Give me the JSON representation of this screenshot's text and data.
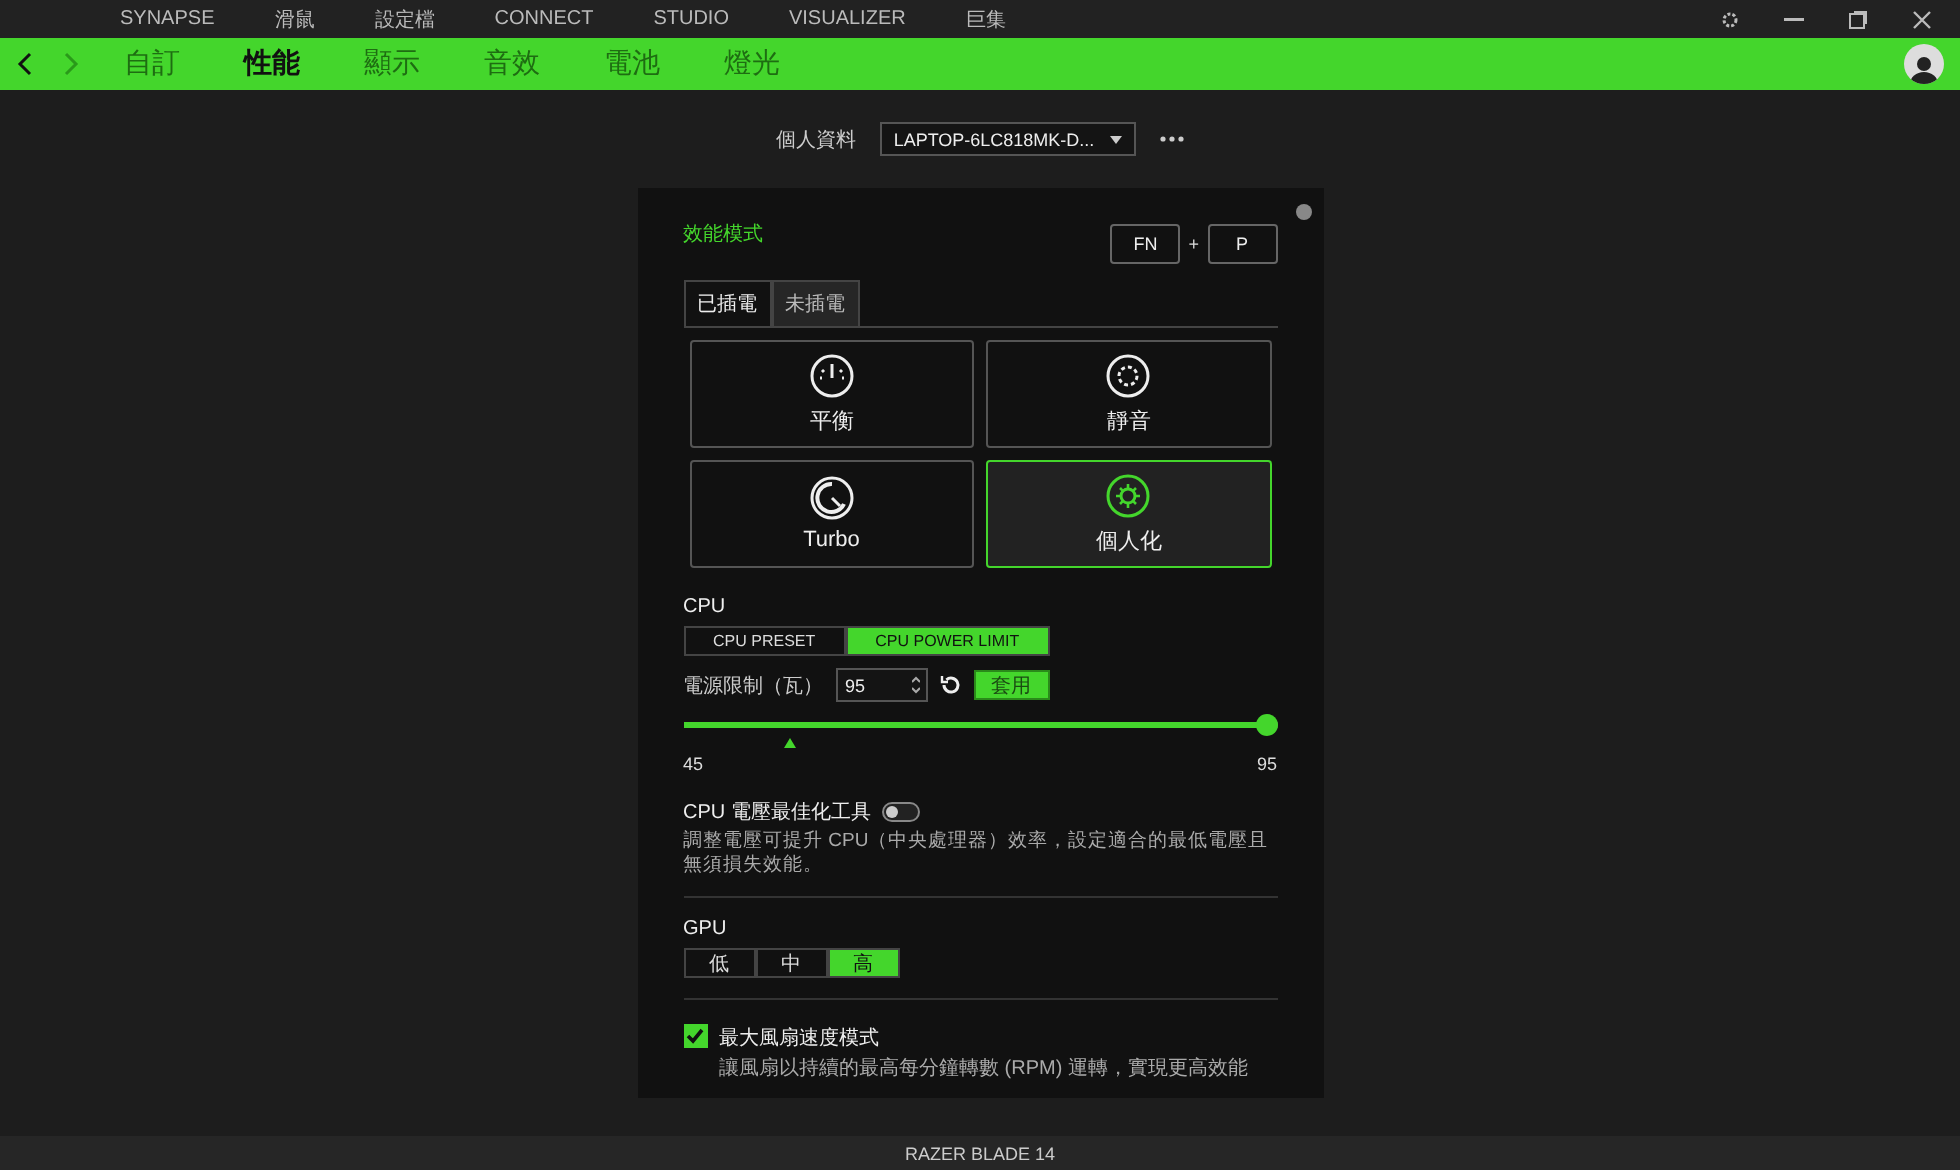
{
  "top_menu": [
    {
      "label": "SYNAPSE",
      "selected": false
    },
    {
      "label": "滑鼠",
      "selected": false
    },
    {
      "label": "設定檔",
      "selected": false
    },
    {
      "label": "CONNECT",
      "selected": false
    },
    {
      "label": "STUDIO",
      "selected": false
    },
    {
      "label": "VISUALIZER",
      "selected": false
    },
    {
      "label": "巨集",
      "selected": false
    }
  ],
  "tabs": [
    {
      "label": "自訂",
      "selected": false
    },
    {
      "label": "性能",
      "selected": true
    },
    {
      "label": "顯示",
      "selected": false
    },
    {
      "label": "音效",
      "selected": false
    },
    {
      "label": "電池",
      "selected": false
    },
    {
      "label": "燈光",
      "selected": false
    }
  ],
  "profile": {
    "label": "個人資料",
    "value": "LAPTOP-6LC818MK-D..."
  },
  "performance": {
    "title": "效能模式",
    "shortcut": [
      "FN",
      "+",
      "P"
    ],
    "power_tabs": [
      {
        "label": "已插電",
        "selected": true
      },
      {
        "label": "未插電",
        "selected": false
      }
    ],
    "modes": [
      {
        "kind": "gauge",
        "label": "平衡",
        "selected": false
      },
      {
        "kind": "fan",
        "label": "靜音",
        "selected": false
      },
      {
        "kind": "turbo",
        "label": "Turbo",
        "selected": false
      },
      {
        "kind": "gear",
        "label": "個人化",
        "selected": true
      }
    ]
  },
  "cpu": {
    "title": "CPU",
    "options": [
      {
        "label": "CPU PRESET",
        "selected": false
      },
      {
        "label": "CPU POWER LIMIT",
        "selected": true
      }
    ],
    "power_limit": {
      "label": "電源限制（瓦）",
      "value": "95",
      "apply": "套用",
      "level": 1,
      "min": "45",
      "max": "95"
    },
    "undervolt": {
      "label": "CPU 電壓最佳化工具",
      "on": false,
      "description": "調整電壓可提升 CPU（中央處理器）效率，設定適合的最低電壓且無須損失效能。"
    }
  },
  "gpu": {
    "title": "GPU",
    "options": [
      {
        "label": "低",
        "selected": false
      },
      {
        "label": "中",
        "selected": false
      },
      {
        "label": "高",
        "selected": true
      }
    ]
  },
  "fan": {
    "label": "最大風扇速度模式",
    "checked": true,
    "description": "讓風扇以持續的最高每分鐘轉數 (RPM) 運轉，實現更高效能"
  },
  "status_bar": "RAZER BLADE 14"
}
